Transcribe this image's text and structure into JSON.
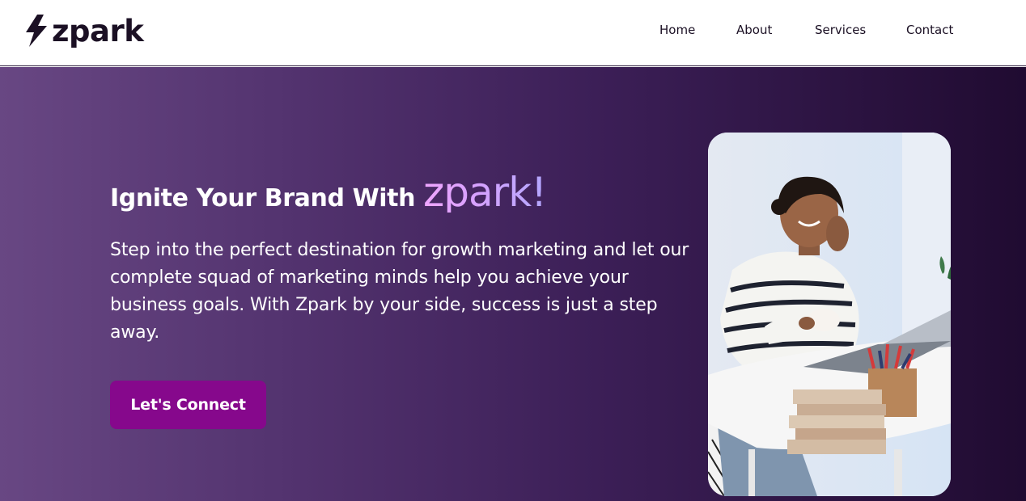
{
  "brand": {
    "name": "zpark",
    "logo_icon": "lightning-bolt-icon",
    "text_color": "#1b1024"
  },
  "nav": {
    "items": [
      {
        "label": "Home"
      },
      {
        "label": "About"
      },
      {
        "label": "Services"
      },
      {
        "label": "Contact"
      }
    ]
  },
  "hero": {
    "headline_prefix": "Ignite Your Brand With",
    "headline_brand": "zpark!",
    "subtitle": "Step into the perfect destination for growth marketing and let our complete squad of marketing minds help you achieve your business goals. With Zpark by your side, success is just a step away.",
    "cta_label": "Let's Connect",
    "background_gradient": [
      "#684783",
      "#53336f",
      "#3c1f57",
      "#200b31"
    ],
    "cta_color": "#86088c",
    "image": "woman-working-at-desk-photo"
  }
}
